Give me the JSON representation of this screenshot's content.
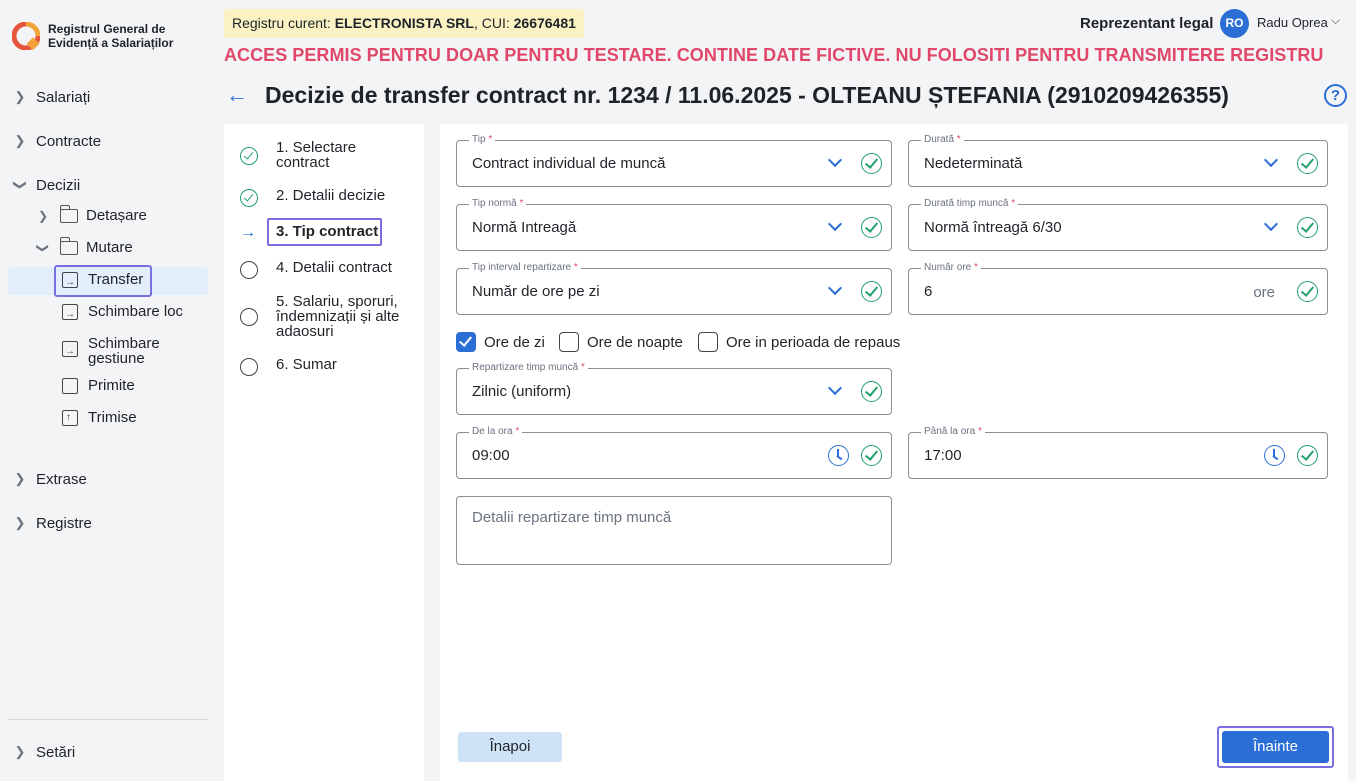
{
  "app": {
    "logo_line1": "Registrul General de",
    "logo_line2": "Evidență a Salariaților"
  },
  "sidebar": {
    "salariati": "Salariați",
    "contracte": "Contracte",
    "decizii": "Decizii",
    "detasare": "Detașare",
    "mutare": "Mutare",
    "transfer": "Transfer",
    "schimbare_loc": "Schimbare loc",
    "schimbare_gestiune_1": "Schimbare",
    "schimbare_gestiune_2": "gestiune",
    "primite": "Primite",
    "trimise": "Trimise",
    "extrase": "Extrase",
    "registre": "Registre",
    "setari": "Setări"
  },
  "header": {
    "registry_prefix": "Registru curent: ",
    "company": "ELECTRONISTA SRL",
    "cui_prefix": ", CUI: ",
    "cui": "26676481",
    "role": "Reprezentant legal",
    "avatar_initials": "RO",
    "user_name": "Radu Oprea",
    "warning": "ACCES PERMIS PENTRU DOAR PENTRU TESTARE. CONTINE DATE FICTIVE. NU FOLOSITI PENTRU TRANSMITERE REGISTRU",
    "page_title": "Decizie de transfer contract nr. 1234 / 11.06.2025 - OLTEANU  ȘTEFANIA (2910209426355)",
    "help": "?"
  },
  "steps": [
    {
      "label": "1. Selectare contract",
      "state": "done"
    },
    {
      "label": "2. Detalii decizie",
      "state": "done"
    },
    {
      "label": "3. Tip contract",
      "state": "current"
    },
    {
      "label": "4. Detalii contract",
      "state": "todo"
    },
    {
      "label": "5. Salariu, sporuri, îndemnizații și alte adaosuri",
      "state": "todo"
    },
    {
      "label": "6. Sumar",
      "state": "todo"
    }
  ],
  "form": {
    "tip": {
      "label": "Tip",
      "value": "Contract individual de muncă"
    },
    "durata": {
      "label": "Durată",
      "value": "Nedeterminată"
    },
    "tip_norma": {
      "label": "Tip normă",
      "value": "Normă Intreagă"
    },
    "durata_timp": {
      "label": "Durată timp muncă",
      "value": "Normă întreagă 6/30"
    },
    "tip_interval": {
      "label": "Tip interval repartizare",
      "value": "Număr de ore pe zi"
    },
    "numar_ore": {
      "label": "Număr ore",
      "value": "6",
      "unit": "ore"
    },
    "checkboxes": {
      "ore_zi": {
        "label": "Ore de zi",
        "checked": true
      },
      "ore_noapte": {
        "label": "Ore de noapte",
        "checked": false
      },
      "ore_repaus": {
        "label": "Ore in perioada de repaus",
        "checked": false
      }
    },
    "repartizare": {
      "label": "Repartizare timp muncă",
      "value": "Zilnic (uniform)"
    },
    "de_la": {
      "label": "De la ora",
      "value": "09:00"
    },
    "pana_la": {
      "label": "Până la ora",
      "value": "17:00"
    },
    "detalii_placeholder": "Detalii repartizare timp muncă",
    "required_mark": "*"
  },
  "buttons": {
    "back": "Înapoi",
    "next": "Înainte"
  },
  "colors": {
    "accent": "#2b6fd6",
    "success": "#22a06b",
    "warning_text": "#e0476a",
    "focus_outline": "#7b6fe0"
  }
}
